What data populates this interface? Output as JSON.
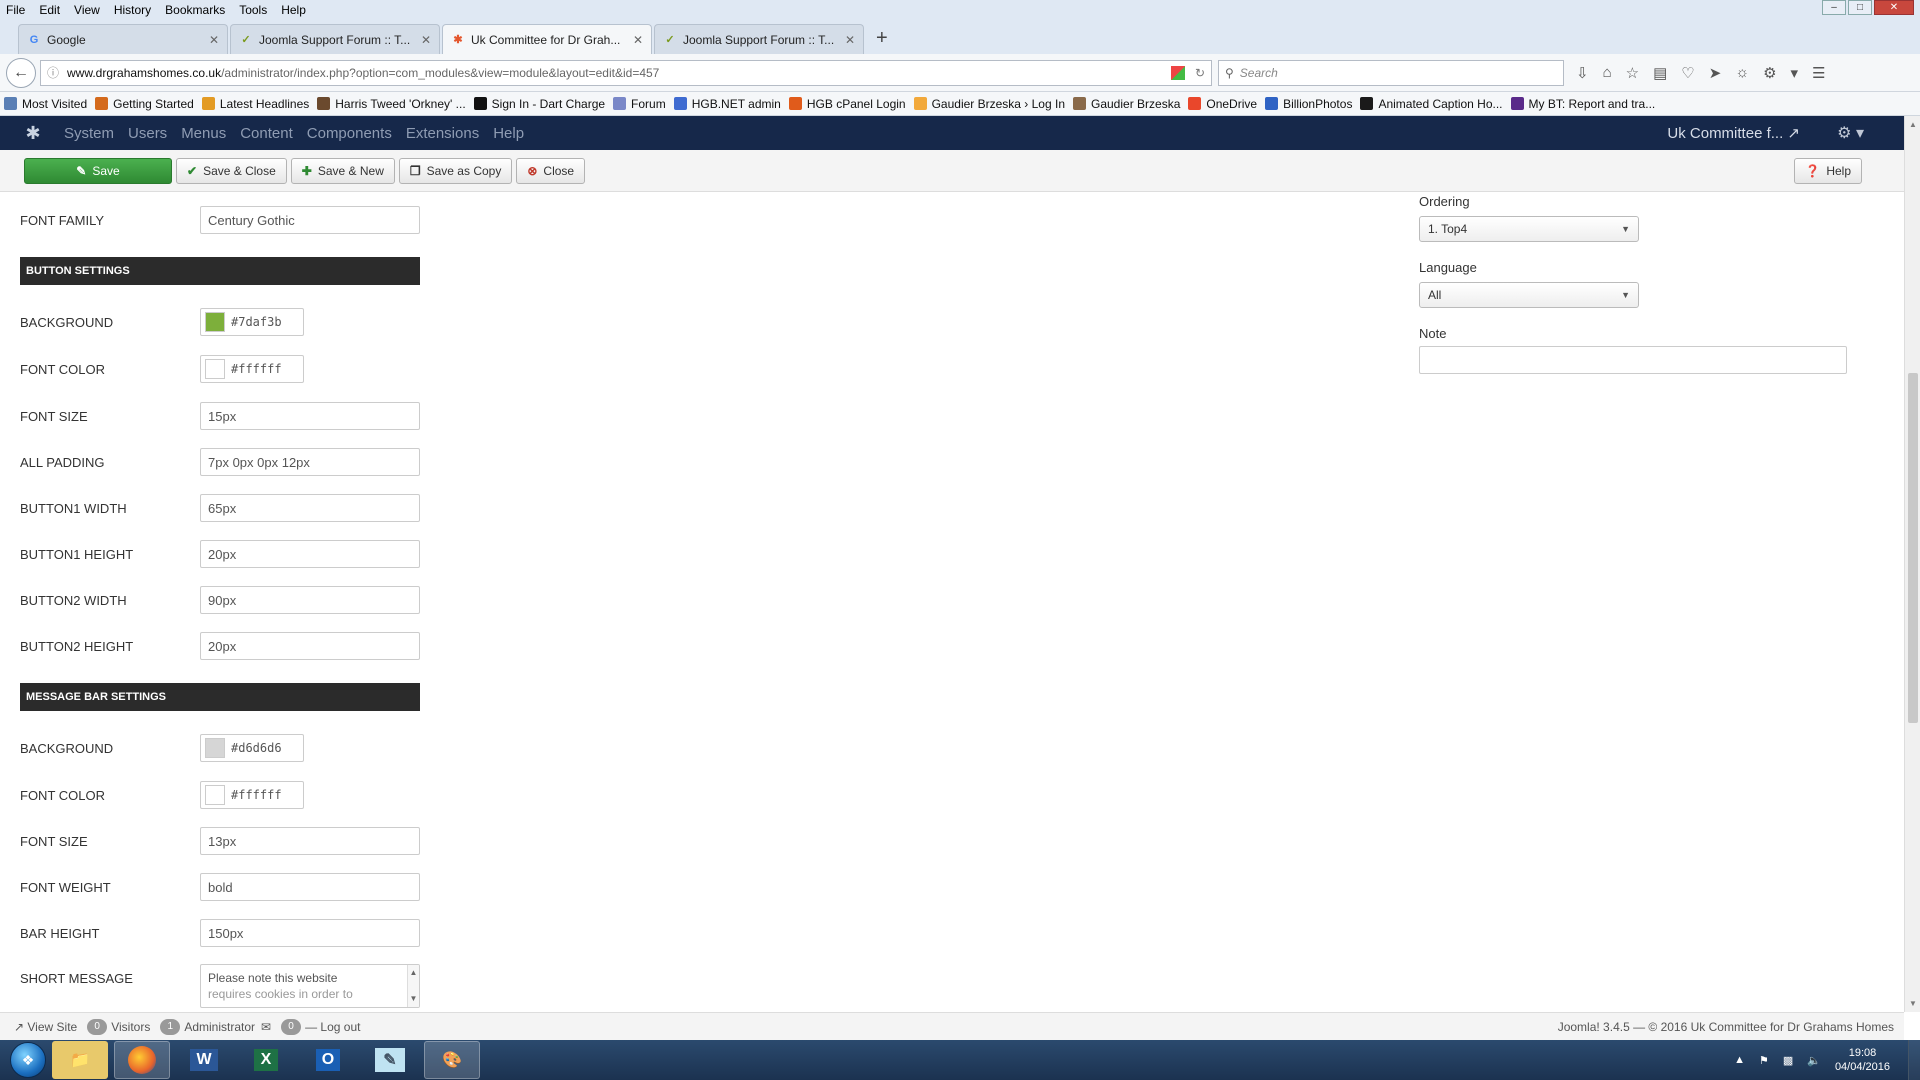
{
  "menubar": [
    "File",
    "Edit",
    "View",
    "History",
    "Bookmarks",
    "Tools",
    "Help"
  ],
  "tabs": [
    {
      "title": "Google",
      "favicon": "G"
    },
    {
      "title": "Joomla Support Forum :: T...",
      "favicon": "J"
    },
    {
      "title": "Uk Committee for Dr Grah...",
      "favicon": "X"
    },
    {
      "title": "Joomla Support Forum :: T...",
      "favicon": "J"
    }
  ],
  "address": {
    "domain": "www.drgrahamshomes.co.uk",
    "path": "/administrator/index.php?option=com_modules&view=module&layout=edit&id=457"
  },
  "search": {
    "placeholder": "Search"
  },
  "bookmarks": [
    {
      "label": "Most Visited",
      "color": "#5a7fb5"
    },
    {
      "label": "Getting Started",
      "color": "#d46a1c"
    },
    {
      "label": "Latest Headlines",
      "color": "#e39b24"
    },
    {
      "label": "Harris Tweed 'Orkney' ...",
      "color": "#6b4a2e"
    },
    {
      "label": "Sign In - Dart Charge",
      "color": "#111111"
    },
    {
      "label": "Forum",
      "color": "#7a88c8"
    },
    {
      "label": "HGB.NET admin",
      "color": "#3e6bd1"
    },
    {
      "label": "HGB cPanel Login",
      "color": "#e05b1b"
    },
    {
      "label": "Gaudier Brzeska › Log In",
      "color": "#f2a93b"
    },
    {
      "label": "Gaudier Brzeska",
      "color": "#8a6a4a"
    },
    {
      "label": "OneDrive",
      "color": "#e9472b"
    },
    {
      "label": "BillionPhotos",
      "color": "#2f63c4"
    },
    {
      "label": "Animated Caption Ho...",
      "color": "#1a1a1a"
    },
    {
      "label": "My BT: Report and tra...",
      "color": "#5a2a8a"
    }
  ],
  "joomla_nav": {
    "items": [
      "System",
      "Users",
      "Menus",
      "Content",
      "Components",
      "Extensions",
      "Help"
    ],
    "site_name": "Uk Committee f..."
  },
  "toolbar": {
    "save": "Save",
    "save_close": "Save & Close",
    "save_new": "Save & New",
    "save_copy": "Save as Copy",
    "close": "Close",
    "help": "Help"
  },
  "form": {
    "font_family": {
      "label": "FONT FAMILY",
      "value": "Century Gothic"
    },
    "button_section": "BUTTON SETTINGS",
    "btn_background": {
      "label": "BACKGROUND",
      "value": "#7daf3b",
      "color": "#7daf3b"
    },
    "btn_font_color": {
      "label": "FONT COLOR",
      "value": "#ffffff",
      "color": "#ffffff"
    },
    "btn_font_size": {
      "label": "FONT SIZE",
      "value": "15px"
    },
    "all_padding": {
      "label": "ALL PADDING",
      "value": "7px 0px 0px 12px"
    },
    "button1_width": {
      "label": "BUTTON1 WIDTH",
      "value": "65px"
    },
    "button1_height": {
      "label": "BUTTON1 HEIGHT",
      "value": "20px"
    },
    "button2_width": {
      "label": "BUTTON2 WIDTH",
      "value": "90px"
    },
    "button2_height": {
      "label": "BUTTON2 HEIGHT",
      "value": "20px"
    },
    "message_section": "MESSAGE BAR SETTINGS",
    "msg_background": {
      "label": "BACKGROUND",
      "value": "#d6d6d6",
      "color": "#d6d6d6"
    },
    "msg_font_color": {
      "label": "FONT COLOR",
      "value": "#ffffff",
      "color": "#ffffff"
    },
    "msg_font_size": {
      "label": "FONT SIZE",
      "value": "13px"
    },
    "font_weight": {
      "label": "FONT WEIGHT",
      "value": "bold"
    },
    "bar_height": {
      "label": "BAR HEIGHT",
      "value": "150px"
    },
    "short_message": {
      "label": "SHORT MESSAGE",
      "line1": "Please note this website",
      "line2": "requires cookies in order to"
    }
  },
  "sidebar": {
    "ordering_label": "Ordering",
    "ordering_value": "1. Top4",
    "language_label": "Language",
    "language_value": "All",
    "note_label": "Note",
    "note_value": ""
  },
  "status": {
    "view_site": "View Site",
    "visitors_count": "0",
    "visitors_label": "Visitors",
    "admin_count": "1",
    "admin_label": "Administrator",
    "messages_count": "0",
    "logout": "Log out",
    "copyright": "Joomla! 3.4.5 — © 2016 Uk Committee for Dr Grahams Homes"
  },
  "taskbar": {
    "time": "19:08",
    "date": "04/04/2016",
    "apps": [
      "explorer",
      "firefox",
      "word",
      "excel",
      "outlook",
      "notepad",
      "paint"
    ]
  }
}
